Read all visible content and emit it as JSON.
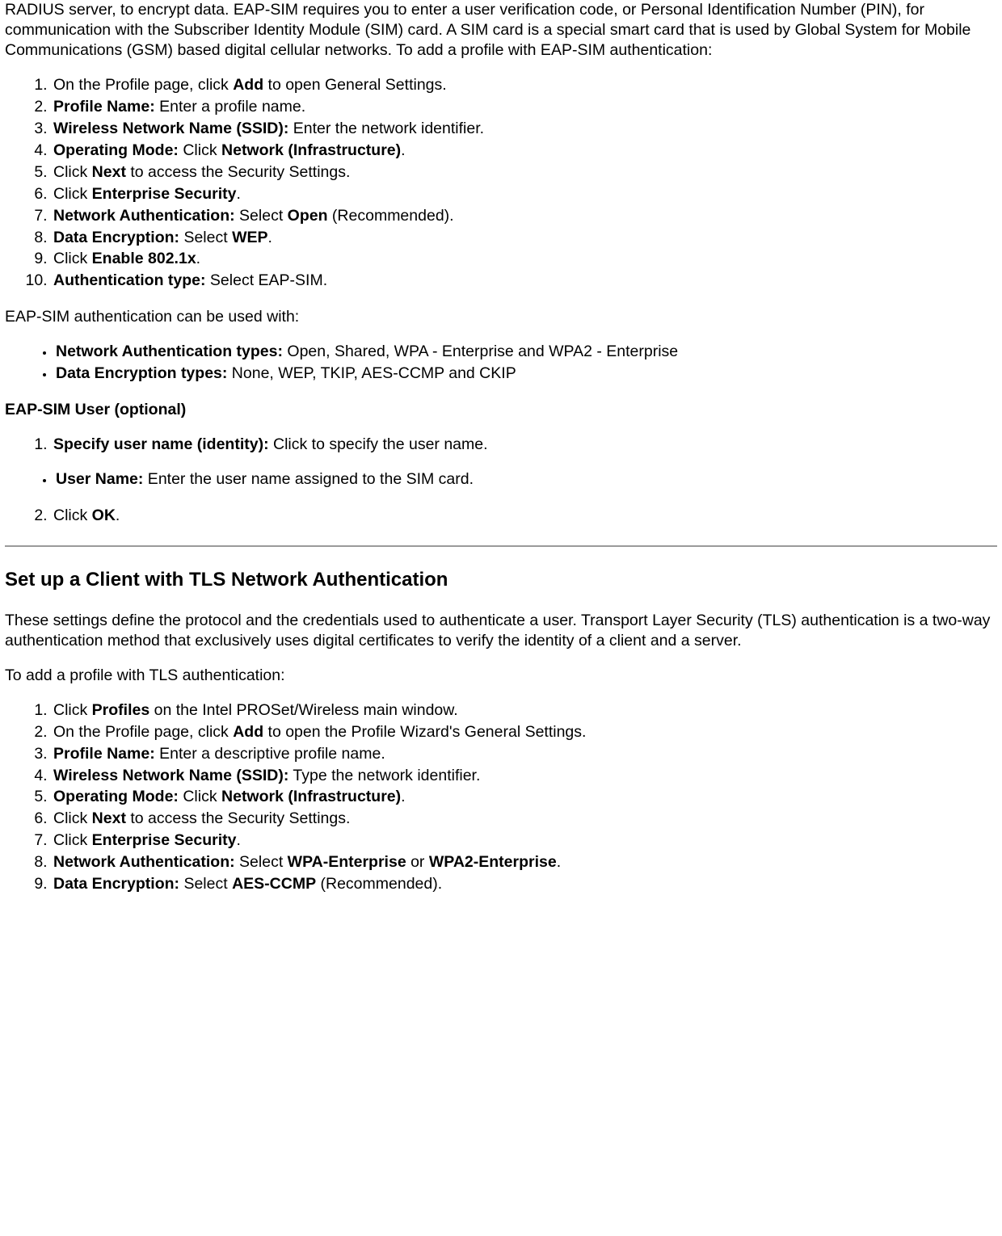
{
  "intro_para": {
    "text": "RADIUS server, to encrypt data. EAP-SIM requires you to enter a user verification code, or Personal Identification Number (PIN), for communication with the Subscriber Identity Module (SIM) card. A SIM card is a special smart card that is used by Global System for Mobile Communications (GSM) based digital cellular networks. To add a profile with EAP-SIM authentication:"
  },
  "ol1": {
    "i1_a": "On the Profile page, click ",
    "i1_b": "Add",
    "i1_c": " to open General Settings.",
    "i2_a": "Profile Name:",
    "i2_b": " Enter a profile name.",
    "i3_a": "Wireless Network Name (SSID):",
    "i3_b": " Enter the network identifier.",
    "i4_a": "Operating Mode:",
    "i4_b": " Click ",
    "i4_c": "Network (Infrastructure)",
    "i4_d": ".",
    "i5_a": "Click ",
    "i5_b": "Next",
    "i5_c": " to access the Security Settings.",
    "i6_a": "Click ",
    "i6_b": "Enterprise Security",
    "i6_c": ".",
    "i7_a": "Network Authentication:",
    "i7_b": " Select ",
    "i7_c": "Open",
    "i7_d": " (Recommended).",
    "i8_a": "Data Encryption:",
    "i8_b": " Select ",
    "i8_c": "WEP",
    "i8_d": ".",
    "i9_a": "Click ",
    "i9_b": "Enable 802.1x",
    "i9_c": ".",
    "i10_a": "Authentication type:",
    "i10_b": " Select EAP-SIM."
  },
  "eap_sim_used_with": "EAP-SIM authentication can be used with:",
  "ul1": {
    "i1_a": "Network Authentication types:",
    "i1_b": " Open, Shared, WPA - Enterprise and WPA2 - Enterprise",
    "i2_a": "Data Encryption types:",
    "i2_b": " None, WEP, TKIP, AES-CCMP and CKIP"
  },
  "eap_sim_user_head": "EAP-SIM User (optional)",
  "ol2": {
    "i1_a": "Specify user name (identity):",
    "i1_b": " Click to specify the user name."
  },
  "ul2": {
    "i1_a": "User Name:",
    "i1_b": " Enter the user name assigned to the SIM card."
  },
  "ol3": {
    "i2_a": "Click ",
    "i2_b": "OK",
    "i2_c": "."
  },
  "tls_heading": "Set up a Client with TLS Network Authentication",
  "tls_para1": "These settings define the protocol and the credentials used to authenticate a user. Transport Layer Security (TLS) authentication is a two-way authentication method that exclusively uses digital certificates to verify the identity of a client and a server.",
  "tls_para2": "To add a profile with TLS authentication:",
  "ol4": {
    "i1_a": "Click ",
    "i1_b": "Profiles",
    "i1_c": " on the Intel PROSet/Wireless main window.",
    "i2_a": "On the Profile page, click ",
    "i2_b": "Add",
    "i2_c": " to open the Profile Wizard's General Settings.",
    "i3_a": "Profile Name:",
    "i3_b": " Enter a descriptive profile name.",
    "i4_a": "Wireless Network Name (SSID):",
    "i4_b": " Type the network identifier.",
    "i5_a": "Operating Mode:",
    "i5_b": " Click ",
    "i5_c": "Network (Infrastructure)",
    "i5_d": ".",
    "i6_a": "Click ",
    "i6_b": "Next",
    "i6_c": " to access the Security Settings.",
    "i7_a": "Click ",
    "i7_b": "Enterprise Security",
    "i7_c": ".",
    "i8_a": "Network Authentication:",
    "i8_b": " Select ",
    "i8_c": "WPA-Enterprise",
    "i8_d": " or ",
    "i8_e": "WPA2-Enterprise",
    "i8_f": ".",
    "i9_a": "Data Encryption:",
    "i9_b": " Select ",
    "i9_c": "AES-CCMP",
    "i9_d": " (Recommended)."
  }
}
